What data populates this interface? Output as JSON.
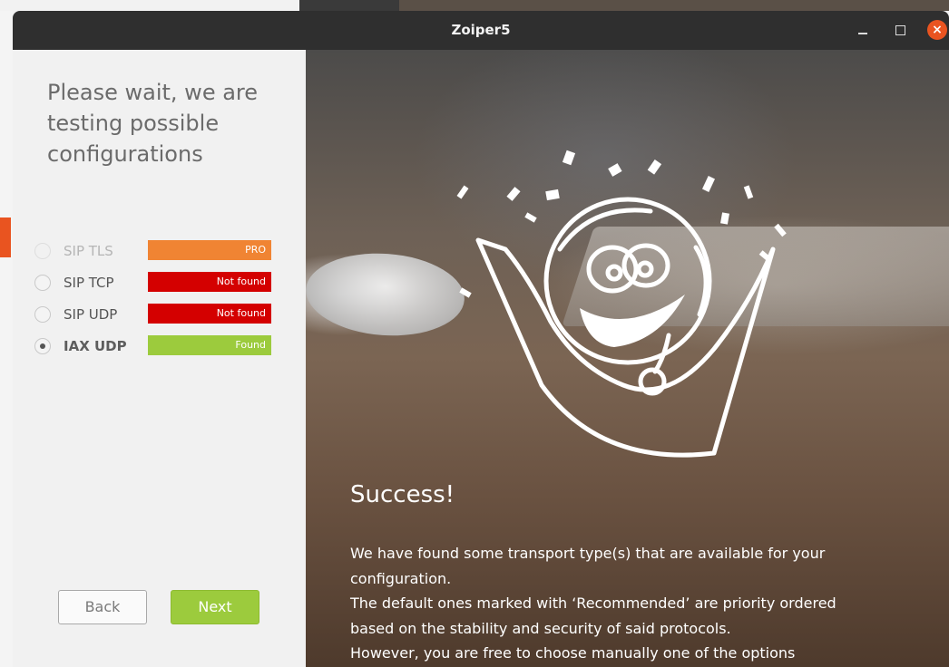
{
  "window": {
    "title": "Zoiper5"
  },
  "left": {
    "heading": "Please wait, we are testing possible configurations",
    "options": [
      {
        "label": "SIP TLS",
        "badge": "PRO",
        "status": "pro",
        "state": "disabled"
      },
      {
        "label": "SIP TCP",
        "badge": "Not found",
        "status": "notfound",
        "state": "unselected"
      },
      {
        "label": "SIP UDP",
        "badge": "Not found",
        "status": "notfound",
        "state": "unselected"
      },
      {
        "label": "IAX UDP",
        "badge": "Found",
        "status": "found",
        "state": "selected"
      }
    ],
    "back_label": "Back",
    "next_label": "Next"
  },
  "right": {
    "success_title": "Success!",
    "lines": [
      "We have found some transport type(s) that are available for your configuration.",
      "The default ones marked with ‘Recommended’ are priority ordered based on the stability and security of said protocols.",
      "However, you are free to choose manually one of the options"
    ]
  },
  "colors": {
    "accent_green": "#9ccb3d",
    "pro_orange": "#f08433",
    "not_found_red": "#d40000",
    "titlebar": "#2f2f2f",
    "close_orange": "#e95420"
  }
}
